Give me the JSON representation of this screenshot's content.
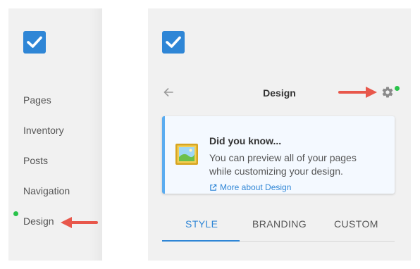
{
  "sidebar": {
    "items": [
      {
        "label": "Pages"
      },
      {
        "label": "Inventory"
      },
      {
        "label": "Posts"
      },
      {
        "label": "Navigation"
      },
      {
        "label": "Design"
      }
    ]
  },
  "panel": {
    "title": "Design",
    "info_card": {
      "title": "Did you know...",
      "body": "You can preview all of your pages while customizing your design.",
      "link": "More about Design"
    },
    "tabs": [
      {
        "label": "STYLE"
      },
      {
        "label": "BRANDING"
      },
      {
        "label": "CUSTOM"
      }
    ]
  },
  "colors": {
    "accent": "#2f86d6",
    "status_dot": "#29c34a",
    "arrow_annotation": "#e8574b"
  },
  "icons": [
    "checkbox-logo-icon",
    "back-arrow-icon",
    "gear-icon",
    "picture-icon",
    "external-link-icon",
    "red-arrow-icon"
  ]
}
